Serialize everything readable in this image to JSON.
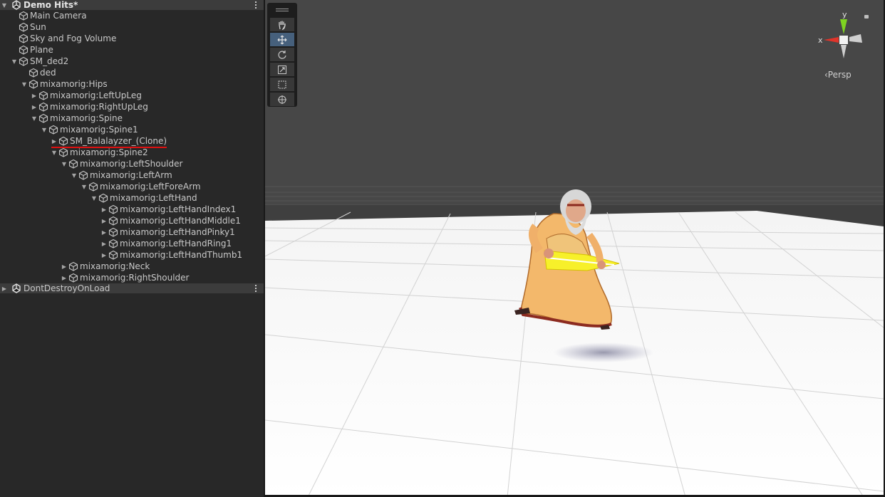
{
  "hierarchy": {
    "scene": {
      "name": "Demo Hits*"
    },
    "items": [
      {
        "label": "Main Camera",
        "depth": 1,
        "expander": "none"
      },
      {
        "label": "Sun",
        "depth": 1,
        "expander": "none"
      },
      {
        "label": "Sky and Fog Volume",
        "depth": 1,
        "expander": "none"
      },
      {
        "label": "Plane",
        "depth": 1,
        "expander": "none"
      },
      {
        "label": "SM_ded2",
        "depth": 1,
        "expander": "expanded"
      },
      {
        "label": "ded",
        "depth": 2,
        "expander": "none"
      },
      {
        "label": "mixamorig:Hips",
        "depth": 2,
        "expander": "expanded"
      },
      {
        "label": "mixamorig:LeftUpLeg",
        "depth": 3,
        "expander": "collapsed"
      },
      {
        "label": "mixamorig:RightUpLeg",
        "depth": 3,
        "expander": "collapsed"
      },
      {
        "label": "mixamorig:Spine",
        "depth": 3,
        "expander": "expanded"
      },
      {
        "label": "mixamorig:Spine1",
        "depth": 4,
        "expander": "expanded"
      },
      {
        "label": "SM_Balalayzer_(Clone)",
        "depth": 5,
        "expander": "collapsed"
      },
      {
        "label": "mixamorig:Spine2",
        "depth": 5,
        "expander": "expanded"
      },
      {
        "label": "mixamorig:LeftShoulder",
        "depth": 6,
        "expander": "expanded"
      },
      {
        "label": "mixamorig:LeftArm",
        "depth": 7,
        "expander": "expanded"
      },
      {
        "label": "mixamorig:LeftForeArm",
        "depth": 8,
        "expander": "expanded"
      },
      {
        "label": "mixamorig:LeftHand",
        "depth": 9,
        "expander": "expanded"
      },
      {
        "label": "mixamorig:LeftHandIndex1",
        "depth": 10,
        "expander": "collapsed"
      },
      {
        "label": "mixamorig:LeftHandMiddle1",
        "depth": 10,
        "expander": "collapsed"
      },
      {
        "label": "mixamorig:LeftHandPinky1",
        "depth": 10,
        "expander": "collapsed"
      },
      {
        "label": "mixamorig:LeftHandRing1",
        "depth": 10,
        "expander": "collapsed"
      },
      {
        "label": "mixamorig:LeftHandThumb1",
        "depth": 10,
        "expander": "collapsed"
      },
      {
        "label": "mixamorig:Neck",
        "depth": 6,
        "expander": "collapsed"
      },
      {
        "label": "mixamorig:RightShoulder",
        "depth": 6,
        "expander": "collapsed"
      }
    ],
    "dont_destroy": {
      "name": "DontDestroyOnLoad"
    },
    "highlighted_item": "SM_Balalayzer_(Clone)"
  },
  "scene_view": {
    "tools": [
      {
        "name": "hand-tool",
        "icon": "hand-icon",
        "active": false
      },
      {
        "name": "move-tool",
        "icon": "move-arrows-icon",
        "active": true
      },
      {
        "name": "rotate-tool",
        "icon": "rotate-icon",
        "active": false
      },
      {
        "name": "scale-tool",
        "icon": "scale-icon",
        "active": false
      },
      {
        "name": "rect-tool",
        "icon": "rect-icon",
        "active": false
      },
      {
        "name": "transform-tool",
        "icon": "transform-icon",
        "active": false
      }
    ],
    "gizmo": {
      "y_label": "y",
      "x_label": "x"
    },
    "projection": "‹Persp",
    "colors": {
      "sky": "#474747",
      "ground": "#ffffff",
      "active_tool": "#46607c",
      "gizmo_y": "#7ed321",
      "gizmo_x": "#e0342a"
    }
  }
}
